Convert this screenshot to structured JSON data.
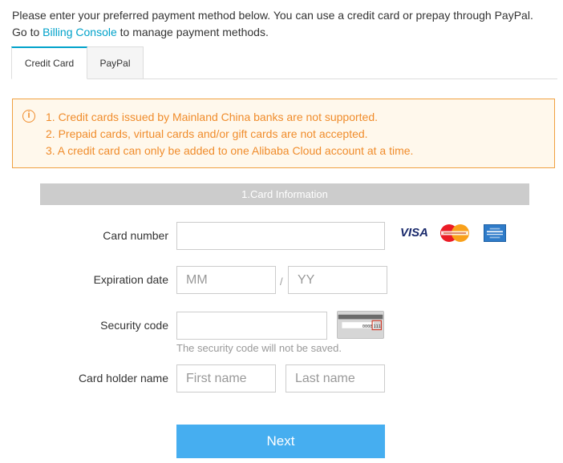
{
  "intro": {
    "line1": "Please enter your preferred payment method below. You can use a credit card or prepay through PayPal.",
    "line2_prefix": "Go to ",
    "billing_link": "Billing Console",
    "line2_suffix": " to manage payment methods."
  },
  "tabs": [
    {
      "label": "Credit Card",
      "active": true
    },
    {
      "label": "PayPal",
      "active": false
    }
  ],
  "notice": {
    "icon": "info-icon",
    "lines": [
      "1. Credit cards issued by Mainland China banks are not supported.",
      "2. Prepaid cards, virtual cards and/or gift cards are not accepted.",
      "3. A credit card can only be added to one Alibaba Cloud account at a time."
    ]
  },
  "section": {
    "title": "1.Card Information"
  },
  "form": {
    "card_number": {
      "label": "Card number",
      "value": "",
      "placeholder": ""
    },
    "expiration": {
      "label": "Expiration date",
      "month_placeholder": "MM",
      "separator": "/",
      "year_placeholder": "YY"
    },
    "security_code": {
      "label": "Security code",
      "value": "",
      "hint": "The security code will not be saved.",
      "card_sample_number": "0008",
      "card_sample_code": "111"
    },
    "holder": {
      "label": "Card holder name",
      "first_placeholder": "First name",
      "last_placeholder": "Last name"
    }
  },
  "card_logos": [
    "VISA",
    "MasterCard",
    "American Express"
  ],
  "next_label": "Next",
  "colors": {
    "accent": "#00a2ca",
    "warning": "#f08c2b",
    "button": "#46aef0",
    "section_bar": "#cccccc"
  }
}
